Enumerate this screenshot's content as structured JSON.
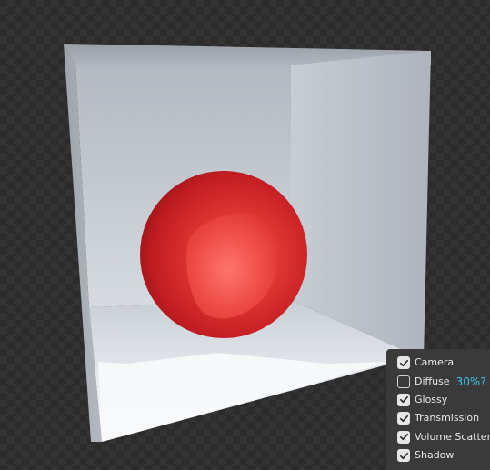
{
  "visibility_panel": {
    "items": [
      {
        "label": "Camera",
        "checked": true,
        "annotation": ""
      },
      {
        "label": "Diffuse",
        "checked": false,
        "annotation": "30%?"
      },
      {
        "label": "Glossy",
        "checked": true,
        "annotation": ""
      },
      {
        "label": "Transmission",
        "checked": true,
        "annotation": ""
      },
      {
        "label": "Volume Scatter",
        "checked": true,
        "annotation": ""
      },
      {
        "label": "Shadow",
        "checked": true,
        "annotation": ""
      }
    ]
  },
  "colors": {
    "sphere": "#e0282b",
    "annotation": "#3ec2e8",
    "panel_background": "#3a3a3a",
    "room_walls": "#b9bec6",
    "floor": "#f4f6f8"
  }
}
